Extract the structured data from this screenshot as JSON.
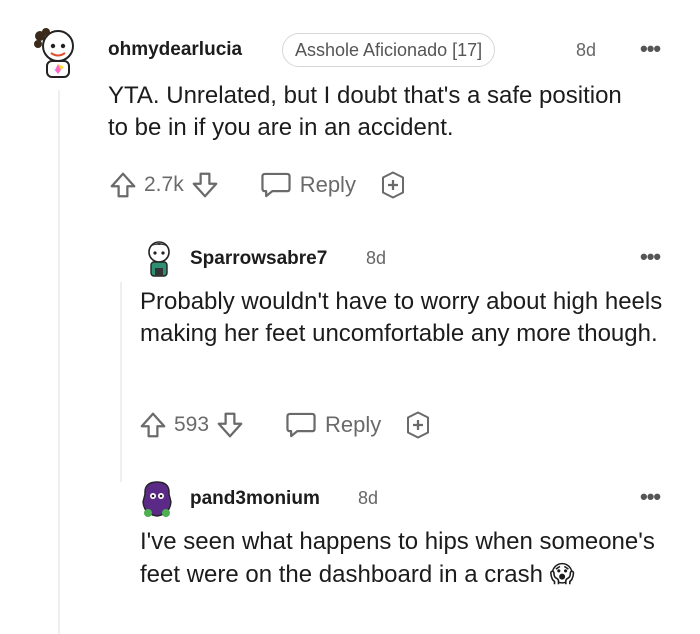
{
  "comments": [
    {
      "username": "ohmydearlucia",
      "flair": "Asshole Aficionado [17]",
      "age": "8d",
      "more": "•••",
      "body": "YTA. Unrelated, but I doubt that's a safe position to be in if you are in an accident.",
      "score": "2.7k",
      "reply_label": "Reply"
    },
    {
      "username": "Sparrowsabre7",
      "age": "8d",
      "more": "•••",
      "body": "Probably wouldn't have to worry about high heels making her feet uncomfortable any more though.",
      "score": "593",
      "reply_label": "Reply"
    },
    {
      "username": "pand3monium",
      "age": "8d",
      "more": "•••",
      "body": "I've seen what happens to hips when someone's feet were on the dashboard in a crash",
      "emoji": "😱"
    }
  ],
  "icons": {
    "upvote": "arrow-up-icon",
    "downvote": "arrow-down-icon",
    "reply": "speech-bubble-icon",
    "award": "plus-award-icon",
    "more": "ellipsis-icon"
  }
}
